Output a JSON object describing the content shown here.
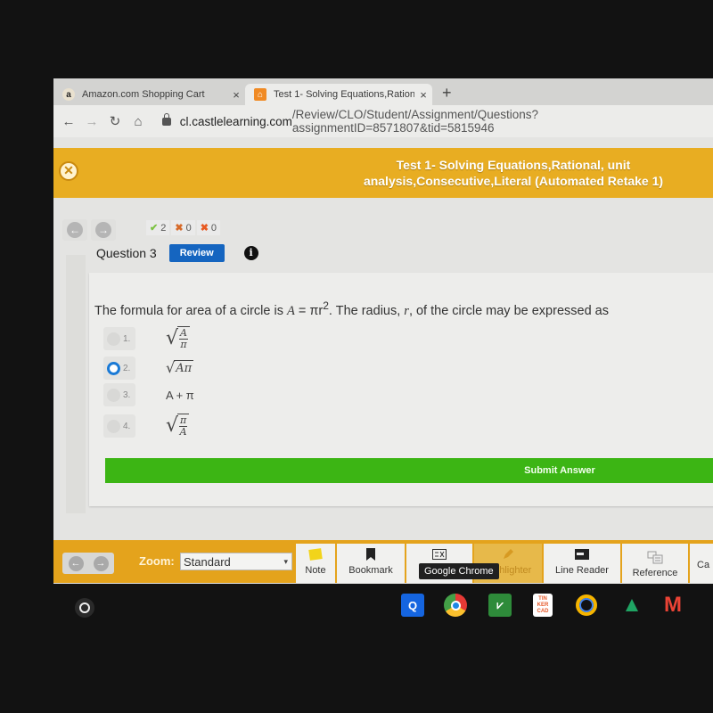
{
  "browser": {
    "tabs": [
      {
        "title": "Amazon.com Shopping Cart",
        "favicon": "amazon-logo",
        "active": false
      },
      {
        "title": "Test 1- Solving Equations,Ration",
        "favicon": "castle-learning-logo",
        "active": true
      }
    ],
    "new_tab_label": "+",
    "close_glyph": "×",
    "url_host": "cl.castlelearning.com",
    "url_path": "/Review/CLO/Student/Assignment/Questions?assignmentID=8571807&tid=5815946"
  },
  "header": {
    "test_title": "Test 1- Solving Equations,Rational, unit analysis,Consecutive,Literal (Automated Retake 1)",
    "exit_glyph": "✕"
  },
  "score": {
    "correct": "2",
    "partial": "0",
    "incorrect": "0"
  },
  "question": {
    "label": "Question 3",
    "review_label": "Review",
    "info_glyph": "i",
    "stem_before": "The formula for area of a circle is ",
    "stem_formula_lhs": "A",
    "stem_formula_rhs": " = πr",
    "stem_exponent": "2",
    "stem_after_1": ". The radius, ",
    "stem_var": "r",
    "stem_after_2": ", of the circle may be expressed as",
    "choices": [
      {
        "num": "1.",
        "expr": "√(A/π)",
        "num_part": "A",
        "den_part": "π",
        "selected": false
      },
      {
        "num": "2.",
        "expr": "√(Aπ)",
        "radicand": "Aπ",
        "selected": true
      },
      {
        "num": "3.",
        "expr": "A + π",
        "selected": false
      },
      {
        "num": "4.",
        "expr": "√(π/A)",
        "num_part": "π",
        "den_part": "A",
        "selected": false
      }
    ],
    "submit_label": "Submit Answer"
  },
  "bottom_toolbar": {
    "zoom_label": "Zoom:",
    "zoom_value": "Standard",
    "tools": [
      {
        "label": "Note",
        "icon": "note-icon"
      },
      {
        "label": "Bookmark",
        "icon": "bookmark-icon"
      },
      {
        "label": "E",
        "icon": "eliminator-icon"
      },
      {
        "label": "Highlighter",
        "icon": "highlighter-icon"
      },
      {
        "label": "Line Reader",
        "icon": "line-reader-icon"
      },
      {
        "label": "Reference",
        "icon": "reference-icon"
      },
      {
        "label": "Ca",
        "icon": "calculator-icon"
      }
    ],
    "tooltip": "Google Chrome"
  },
  "shelf": {
    "apps": [
      {
        "name": "Quizlet",
        "glyph": "Q",
        "color": "#1565e0"
      },
      {
        "name": "Google Chrome",
        "glyph": "",
        "color": "#e53935"
      },
      {
        "name": "Desmos",
        "glyph": "⩗",
        "color": "#2e8b3a"
      },
      {
        "name": "Tinkercad",
        "glyph": "TIN",
        "color": "#e65a2a"
      },
      {
        "name": "Google Jamboard ring",
        "glyph": "◯",
        "color": "#f5b400"
      },
      {
        "name": "Google Drive",
        "glyph": "▲",
        "color": "#1fa463"
      },
      {
        "name": "Gmail",
        "glyph": "M",
        "color": "#ea4335"
      }
    ]
  },
  "colors": {
    "brand_orange": "#e8ad22",
    "submit_green": "#3cb514",
    "review_blue": "#1565c0",
    "radio_selected": "#1a7ad6"
  }
}
